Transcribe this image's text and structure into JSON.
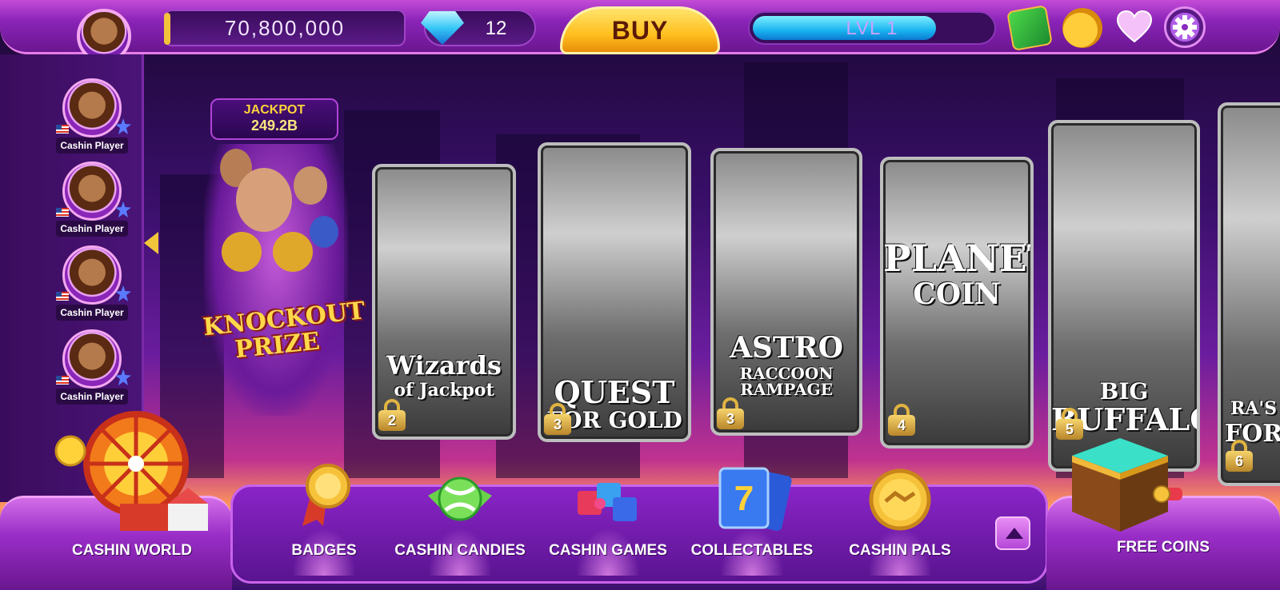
{
  "header": {
    "coins": "70,800,000",
    "gems": "12",
    "buy_label": "BUY",
    "level_label": "LVL 1",
    "level_progress": 0.77
  },
  "sidebar": {
    "players": [
      {
        "label": "Cashin Player"
      },
      {
        "label": "Cashin Player"
      },
      {
        "label": "Cashin Player"
      },
      {
        "label": "Cashin Player"
      }
    ]
  },
  "jackpot": {
    "title": "JACKPOT",
    "value": "249.2B"
  },
  "featured": {
    "title_line1": "KNOCKOUT",
    "title_line2": "PRIZE"
  },
  "games": [
    {
      "title_line1": "Wizards",
      "title_line2": "of Jackpot",
      "lock_level": "2"
    },
    {
      "title_line1": "QUEST",
      "title_line2": "FOR GOLD",
      "lock_level": "3"
    },
    {
      "title_line1": "ASTRO",
      "title_line2": "RACCOON RAMPAGE",
      "lock_level": "3"
    },
    {
      "title_line1": "PLANET",
      "title_line2": "COIN",
      "lock_level": "4"
    },
    {
      "title_line1": "BIG",
      "title_line2": "BUFFALO",
      "lock_level": "5"
    },
    {
      "title_line1": "RA'S",
      "title_line2": "FOR",
      "lock_level": "6"
    }
  ],
  "bottom_nav": {
    "left": "CASHIN WORLD",
    "items": [
      "BADGES",
      "CASHIN CANDIES",
      "CASHIN GAMES",
      "COLLECTABLES",
      "CASHIN PALS"
    ],
    "right": "FREE COINS"
  },
  "colors": {
    "accent_gold": "#ffbf1e",
    "purple_dark": "#3a0c5c",
    "purple_light": "#c44bd6",
    "level_blue": "#1ab4f0"
  },
  "icons": {
    "gem": "diamond-icon",
    "cash": "cash-icon",
    "piggy": "piggy-bank-icon",
    "heart": "heart-icon",
    "settings": "gear-icon"
  }
}
